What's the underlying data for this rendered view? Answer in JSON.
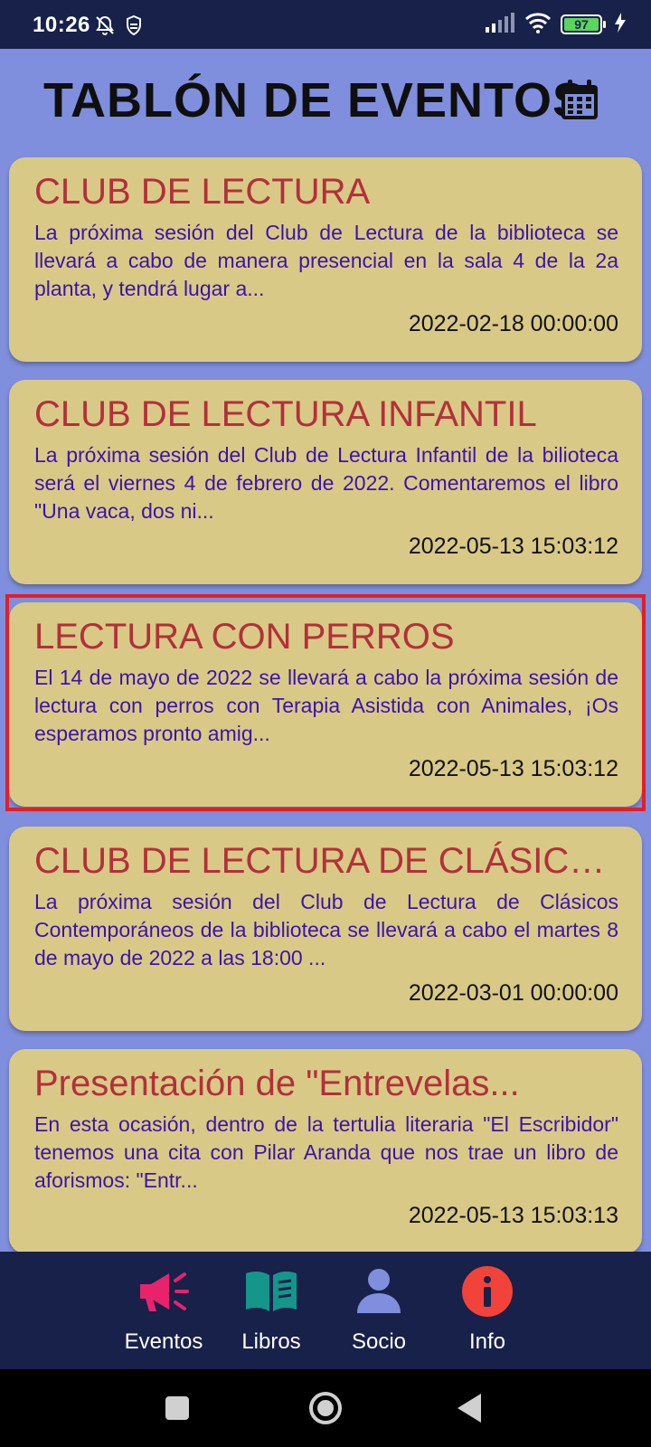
{
  "status_bar": {
    "time": "10:26",
    "icons": [
      "bell-off-icon",
      "shield-icon",
      "signal-icon",
      "wifi-icon",
      "battery-icon",
      "charging-icon"
    ],
    "battery_level": "97"
  },
  "header": {
    "title": "TABLÓN DE EVENTOS",
    "icon": "calendar-icon"
  },
  "events": [
    {
      "title": "CLUB DE LECTURA",
      "description": "La próxima sesión del Club de Lectura de la biblioteca se llevará a cabo de manera presencial en la sala 4 de la 2a planta, y tendrá lugar a...",
      "date": "2022-02-18 00:00:00"
    },
    {
      "title": "CLUB DE LECTURA INFANTIL",
      "description": "La próxima sesión del Club de Lectura Infantil de la bilioteca será el viernes 4 de febrero de 2022. Comentaremos el libro \"Una vaca, dos ni...",
      "date": "2022-05-13 15:03:12"
    },
    {
      "title": "LECTURA CON PERROS",
      "description": "El 14 de mayo de 2022 se llevará a cabo la próxima sesión de lectura con perros con Terapia Asistida con Animales, ¡Os esperamos pronto amig...",
      "date": "2022-05-13 15:03:12"
    },
    {
      "title": "CLUB DE LECTURA DE CLÁSICOS...",
      "description": "La próxima sesión del Club de Lectura de Clásicos Contemporáneos de la biblioteca se llevará a cabo el martes 8 de mayo de 2022 a las 18:00 ...",
      "date": "2022-03-01 00:00:00"
    },
    {
      "title": "Presentación de \"Entrevelas...",
      "description": "En esta ocasión, dentro de la tertulia literaria \"El Escribidor\" tenemos una cita con Pilar Aranda que nos trae un libro de aforismos: \"Entr...",
      "date": "2022-05-13 15:03:13"
    }
  ],
  "bottom_nav": {
    "items": [
      {
        "label": "Eventos",
        "icon": "megaphone-icon",
        "color": "#e8236b"
      },
      {
        "label": "Libros",
        "icon": "book-icon",
        "color": "#14968a"
      },
      {
        "label": "Socio",
        "icon": "person-icon",
        "color": "#7f8fdd"
      },
      {
        "label": "Info",
        "icon": "info-icon",
        "color": "#f2433b"
      }
    ]
  },
  "system_nav": {
    "buttons": [
      "recents-button",
      "home-button",
      "back-button"
    ]
  },
  "colors": {
    "background": "#7f8fdd",
    "card": "#d9c987",
    "card_title": "#b3303a",
    "card_body": "#3d13a8",
    "bars": "#17214a",
    "highlight": "#e01f2a"
  }
}
